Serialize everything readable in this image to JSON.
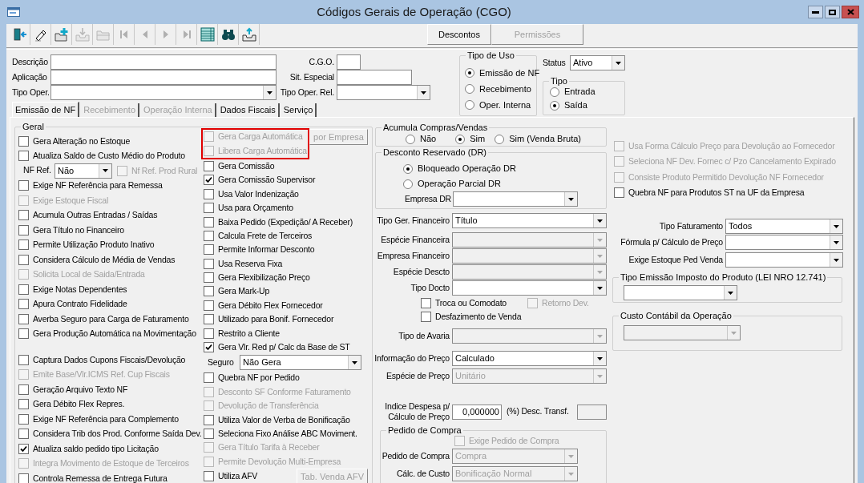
{
  "window": {
    "title": "Códigos Gerais de Operação (CGO)"
  },
  "toolbar": [
    {
      "kind": "exit",
      "disabled": false
    },
    {
      "kind": "edit",
      "disabled": false
    },
    {
      "kind": "add",
      "disabled": false
    },
    {
      "kind": "import",
      "disabled": true
    },
    {
      "kind": "open",
      "disabled": true
    },
    {
      "kind": "first",
      "disabled": true
    },
    {
      "kind": "prev",
      "disabled": true
    },
    {
      "kind": "next",
      "disabled": true
    },
    {
      "kind": "last",
      "disabled": true
    },
    {
      "kind": "grid",
      "disabled": false
    },
    {
      "kind": "search",
      "disabled": false
    },
    {
      "kind": "export",
      "disabled": false
    }
  ],
  "action_buttons": [
    {
      "label": "Descontos",
      "disabled": false
    },
    {
      "label": "Permissões",
      "disabled": true
    }
  ],
  "header": {
    "fields": [
      {
        "label": "Descrição",
        "kind": "text"
      },
      {
        "label": "C.G.O.",
        "kind": "text"
      },
      {
        "label": "Aplicação",
        "kind": "text"
      },
      {
        "label": "Sit. Especial",
        "kind": "text"
      },
      {
        "label": "Tipo Oper.",
        "kind": "select"
      },
      {
        "label": "Tipo Oper. Rel.",
        "kind": "select"
      }
    ]
  },
  "tipo_de_uso": {
    "title": "Tipo de Uso",
    "options": [
      {
        "label": "Emissão de NF",
        "selected": true
      },
      {
        "label": "Recebimento",
        "selected": false
      },
      {
        "label": "Oper. Interna",
        "selected": false
      }
    ]
  },
  "status": {
    "label": "Status",
    "value": "Ativo"
  },
  "tipo": {
    "title": "Tipo",
    "options": [
      {
        "label": "Entrada",
        "selected": false
      },
      {
        "label": "Saída",
        "selected": true
      }
    ]
  },
  "tabs": [
    {
      "label": "Emissão de NF",
      "selected": true,
      "disabled": false
    },
    {
      "label": "Recebimento",
      "selected": false,
      "disabled": true
    },
    {
      "label": "Operação Interna",
      "selected": false,
      "disabled": true
    },
    {
      "label": "Dados Fiscais",
      "selected": false,
      "disabled": false
    },
    {
      "label": "Serviço",
      "selected": false,
      "disabled": false
    }
  ],
  "geral": {
    "title": "Geral",
    "left_items": [
      {
        "kind": "checkbox",
        "label": "Gera Alteração no Estoque",
        "checked": false,
        "disabled": false
      },
      {
        "kind": "checkbox",
        "label": "Atualiza Saldo de Custo Médio do Produto",
        "checked": false,
        "disabled": false
      },
      {
        "kind": "ref",
        "label": "NF Ref.",
        "value": "Não",
        "checkbox": {
          "label": "Nf Ref. Prod Rural",
          "checked": false,
          "disabled": true
        }
      },
      {
        "kind": "checkbox",
        "label": "Exige NF Referência para Remessa",
        "checked": false,
        "disabled": false
      },
      {
        "kind": "checkbox",
        "label": "Exige Estoque Fiscal",
        "checked": false,
        "disabled": true
      },
      {
        "kind": "checkbox",
        "label": "Acumula Outras Entradas / Saídas",
        "checked": false,
        "disabled": false
      },
      {
        "kind": "checkbox",
        "label": "Gera Título no Financeiro",
        "checked": false,
        "disabled": false
      },
      {
        "kind": "checkbox",
        "label": "Permite Utilização Produto Inativo",
        "checked": false,
        "disabled": false
      },
      {
        "kind": "checkbox",
        "label": "Considera Cálculo de Média de Vendas",
        "checked": false,
        "disabled": false
      },
      {
        "kind": "checkbox",
        "label": "Solicita Local de Saida/Entrada",
        "checked": false,
        "disabled": true
      },
      {
        "kind": "checkbox",
        "label": "Exige Notas Dependentes",
        "checked": false,
        "disabled": false
      },
      {
        "kind": "checkbox",
        "label": "Apura Contrato Fidelidade",
        "checked": false,
        "disabled": false
      },
      {
        "kind": "checkbox",
        "label": "Averba Seguro para Carga de Faturamento",
        "checked": false,
        "disabled": false
      },
      {
        "kind": "checkbox",
        "label": "Gera Produção Automática na Movimentação",
        "checked": false,
        "disabled": false
      },
      {
        "kind": "checkbox",
        "label": "Captura Dados Cupons Fiscais/Devolução",
        "checked": false,
        "disabled": false
      },
      {
        "kind": "checkbox",
        "label": "Emite Base/Vlr.ICMS Ref. Cup Fiscais",
        "checked": false,
        "disabled": true
      },
      {
        "kind": "checkbox",
        "label": "Geração Arquivo Texto NF",
        "checked": false,
        "disabled": false
      },
      {
        "kind": "checkbox",
        "label": "Gera Débito Flex Repres.",
        "checked": false,
        "disabled": false
      },
      {
        "kind": "checkbox",
        "label": "Exige NF Referência para Complemento",
        "checked": false,
        "disabled": false
      },
      {
        "kind": "checkbox",
        "label": "Considera Trib dos Prod. Conforme Saída Dev.",
        "checked": false,
        "disabled": false
      },
      {
        "kind": "checkbox",
        "label": "Atualiza saldo pedido tipo Licitação",
        "checked": true,
        "disabled": false
      },
      {
        "kind": "checkbox",
        "label": "Integra Movimento de Estoque de Terceiros",
        "checked": false,
        "disabled": true
      },
      {
        "kind": "checkbox",
        "label": "Controla Remessa de Entrega Futura",
        "checked": false,
        "disabled": false
      }
    ],
    "middle_items": [
      {
        "kind": "checkbox",
        "label": "Gera Carga Automática",
        "checked": false,
        "disabled": true,
        "highlighted": true,
        "button": {
          "label": "por Empresa",
          "disabled": true
        }
      },
      {
        "kind": "checkbox",
        "label": "Libera Carga Automática",
        "checked": false,
        "disabled": true,
        "highlighted": true
      },
      {
        "kind": "checkbox",
        "label": "Gera Comissão",
        "checked": false,
        "disabled": false,
        "highlighted": false
      },
      {
        "kind": "checkbox",
        "label": "Gera Comissão Supervisor",
        "checked": true,
        "disabled": false,
        "highlighted": false
      },
      {
        "kind": "checkbox",
        "label": "Usa Valor Indenização",
        "checked": false,
        "disabled": false,
        "highlighted": false
      },
      {
        "kind": "checkbox",
        "label": "Usa para Orçamento",
        "checked": false,
        "disabled": false,
        "highlighted": false
      },
      {
        "kind": "checkbox",
        "label": "Baixa Pedido (Expedição/ A Receber)",
        "checked": false,
        "disabled": false,
        "highlighted": false
      },
      {
        "kind": "checkbox",
        "label": "Calcula Frete de Terceiros",
        "checked": false,
        "disabled": false,
        "highlighted": false
      },
      {
        "kind": "checkbox",
        "label": "Permite Informar Desconto",
        "checked": false,
        "disabled": false,
        "highlighted": false
      },
      {
        "kind": "checkbox",
        "label": "Usa Reserva Fixa",
        "checked": false,
        "disabled": false,
        "highlighted": false
      },
      {
        "kind": "checkbox",
        "label": "Gera Flexibilização Preço",
        "checked": false,
        "disabled": false,
        "highlighted": false
      },
      {
        "kind": "checkbox",
        "label": "Gera Mark-Up",
        "checked": false,
        "disabled": false,
        "highlighted": false
      },
      {
        "kind": "checkbox",
        "label": "Gera Débito Flex Fornecedor",
        "checked": false,
        "disabled": false,
        "highlighted": false
      },
      {
        "kind": "checkbox",
        "label": "Utilizado para Bonif. Fornecedor",
        "checked": false,
        "disabled": false,
        "highlighted": false
      },
      {
        "kind": "checkbox",
        "label": "Restrito a Cliente",
        "checked": false,
        "disabled": false,
        "highlighted": false
      },
      {
        "kind": "checkbox",
        "label": "Gera Vlr. Red p/ Calc da Base de ST",
        "checked": true,
        "disabled": false,
        "highlighted": false
      },
      {
        "kind": "select",
        "label": "Seguro",
        "value": "Não Gera",
        "highlighted": false
      },
      {
        "kind": "checkbox",
        "label": "Quebra NF por Pedido",
        "checked": false,
        "disabled": false,
        "highlighted": false
      },
      {
        "kind": "checkbox",
        "label": "Desconto SF Conforme Faturamento",
        "checked": false,
        "disabled": true,
        "highlighted": false
      },
      {
        "kind": "checkbox",
        "label": "Devolução de Transferência",
        "checked": false,
        "disabled": true,
        "highlighted": false
      },
      {
        "kind": "checkbox",
        "label": "Utiliza Valor de Verba de Bonificação",
        "checked": false,
        "disabled": false,
        "highlighted": false
      },
      {
        "kind": "checkbox",
        "label": "Seleciona Fixo Análise ABC Moviment.",
        "checked": false,
        "disabled": false,
        "highlighted": false
      },
      {
        "kind": "checkbox",
        "label": "Gera Título Tarifa à Receber",
        "checked": false,
        "disabled": true,
        "highlighted": false
      },
      {
        "kind": "checkbox",
        "label": "Permite Devolução Multi-Empresa",
        "checked": false,
        "disabled": true,
        "highlighted": false
      },
      {
        "kind": "checkbox",
        "label": "Utiliza AFV",
        "checked": false,
        "disabled": false,
        "highlighted": false,
        "button": {
          "label": "Tab. Venda AFV",
          "disabled": true
        }
      }
    ]
  },
  "acumula": {
    "title": "Acumula Compras/Vendas",
    "options": [
      {
        "label": "Não",
        "selected": false
      },
      {
        "label": "Sim",
        "selected": true
      },
      {
        "label": "Sim (Venda Bruta)",
        "selected": false
      }
    ]
  },
  "desconto_reservado": {
    "title": "Desconto Reservado (DR)",
    "options": [
      {
        "label": "Bloqueado Operação DR",
        "selected": true
      },
      {
        "label": "Operação Parcial DR",
        "selected": false
      }
    ],
    "empresa": {
      "label": "Empresa DR",
      "disabled": false
    }
  },
  "financeiro": [
    {
      "kind": "select",
      "label": "Tipo Ger. Financeiro",
      "value": "Título",
      "disabled": false
    },
    {
      "kind": "select",
      "label": "Espécie Financeira",
      "disabled": true
    },
    {
      "kind": "select",
      "label": "Empresa Financeiro",
      "disabled": true
    },
    {
      "kind": "select",
      "label": "Espécie Descto",
      "disabled": true
    },
    {
      "kind": "select",
      "label": "Tipo Docto",
      "disabled": false
    },
    {
      "kind": "checks",
      "items": [
        {
          "label": "Troca ou Comodato",
          "checked": false,
          "disabled": false
        },
        {
          "label": "Retorno Dev.",
          "checked": false,
          "disabled": true
        }
      ]
    },
    {
      "kind": "checks",
      "items": [
        {
          "label": "Desfazimento de Venda",
          "checked": false,
          "disabled": false
        }
      ]
    },
    {
      "kind": "select",
      "label": "Tipo de Avaria",
      "disabled": true
    },
    {
      "kind": "select",
      "label": "Informação do Preço",
      "value": "Calculado",
      "disabled": false
    },
    {
      "kind": "select",
      "label": "Espécie de Preço",
      "value": "Unitário",
      "disabled": true
    },
    {
      "kind": "indice",
      "label": "Indice Despesa p/ Cálculo de Preço",
      "value": "0,000000",
      "extra_label": "(%) Desc. Transf.",
      "extra_disabled": true
    }
  ],
  "pedido_de_compra": {
    "title": "Pedido de Compra",
    "check": {
      "label": "Exige Pedido de Compra",
      "checked": false,
      "disabled": true
    },
    "fields": [
      {
        "label": "Pedido de Compra",
        "value": "Compra",
        "disabled": true
      },
      {
        "label": "Cálc. de Custo",
        "value": "Bonificação Normal",
        "disabled": true
      }
    ]
  },
  "devolucao_checks": [
    {
      "label": "Usa Forma Cálculo Preço para Devolução ao Fornecedor",
      "checked": false,
      "disabled": true
    },
    {
      "label": "Seleciona NF Dev. Fornec c/ Pzo Cancelamento Expirado",
      "checked": false,
      "disabled": true
    },
    {
      "label": "Consiste Produto Permitido Devolução NF Fornecedor",
      "checked": false,
      "disabled": true
    },
    {
      "label": "Quebra NF para Produtos ST na UF da Empresa",
      "checked": false,
      "disabled": false
    }
  ],
  "faturamento": [
    {
      "label": "Tipo Faturamento",
      "value": "Todos",
      "disabled": false
    },
    {
      "label": "Fórmula p/ Cálculo de Preço",
      "disabled": false
    },
    {
      "label": "Exige Estoque Ped Venda",
      "disabled": false
    }
  ],
  "tipo_emissao": {
    "title": "Tipo Emissão Imposto do Produto (LEI NRO 12.741)",
    "disabled": false
  },
  "custo_contabil": {
    "title": "Custo Contábil da Operação",
    "disabled": true
  }
}
